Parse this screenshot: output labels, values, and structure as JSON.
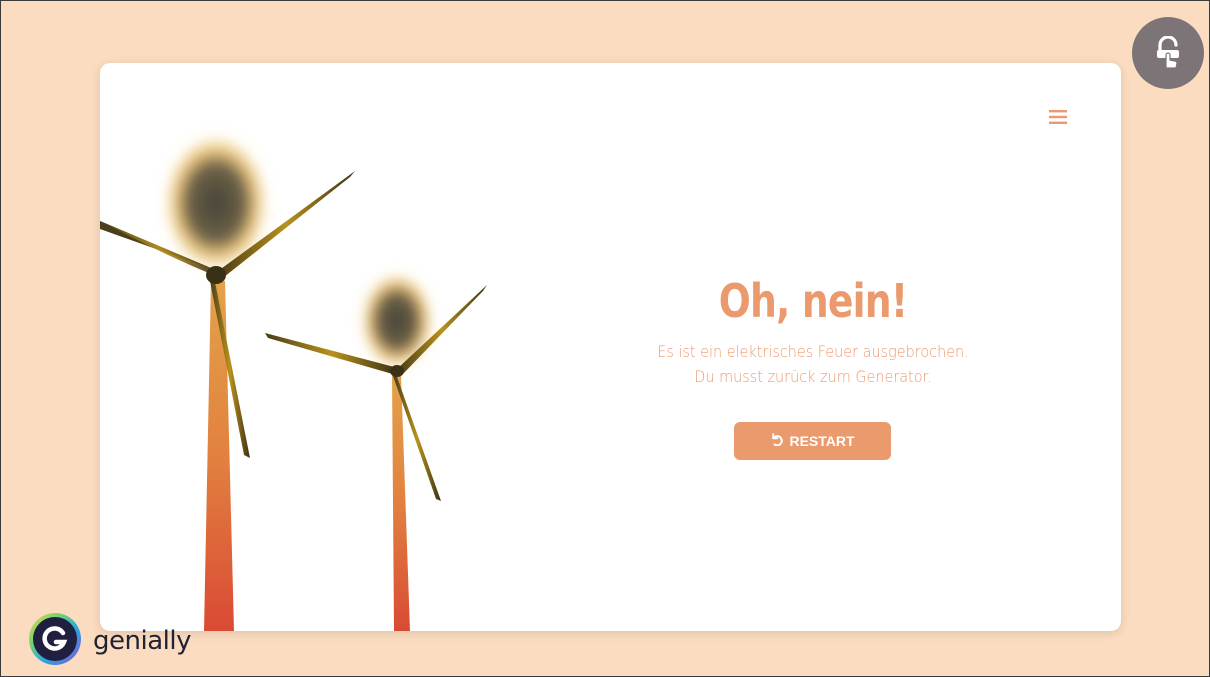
{
  "screen": {
    "title": "Oh, nein!",
    "message_line1": "Es ist ein elektrisches Feuer ausgebrochen.",
    "message_line2": "Du musst zurück zum Generator.",
    "restart_label": "RESTART"
  },
  "branding": {
    "name": "genially"
  },
  "icons": {
    "menu": "hamburger-menu-icon",
    "restart": "undo-arrow-icon",
    "lock": "unlock-touch-icon",
    "logo": "genially-logo-icon"
  },
  "colors": {
    "background": "#fbdcc0",
    "accent": "#ea9a6c",
    "card": "#ffffff",
    "lock_button": "#7c7476"
  }
}
